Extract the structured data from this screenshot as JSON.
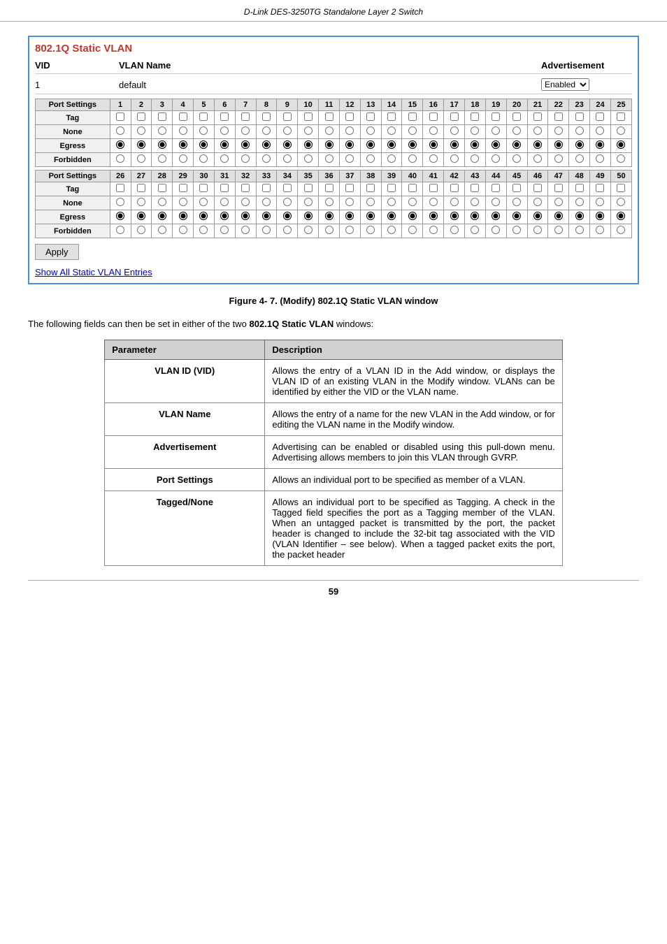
{
  "header": {
    "title": "D-Link DES-3250TG Standalone Layer 2 Switch"
  },
  "vlan_panel": {
    "title": "802.1Q Static VLAN",
    "vid_label": "VID",
    "vlan_name_label": "VLAN Name",
    "advertisement_label": "Advertisement",
    "vid_value": "1",
    "vlan_name_value": "default",
    "advertisement_value": "Enabled",
    "port_settings_label": "Port Settings",
    "tag_label": "Tag",
    "none_label": "None",
    "egress_label": "Egress",
    "forbidden_label": "Forbidden",
    "ports_row1": [
      1,
      2,
      3,
      4,
      5,
      6,
      7,
      8,
      9,
      10,
      11,
      12,
      13,
      14,
      15,
      16,
      17,
      18,
      19,
      20,
      21,
      22,
      23,
      24,
      25
    ],
    "ports_row2": [
      26,
      27,
      28,
      29,
      30,
      31,
      32,
      33,
      34,
      35,
      36,
      37,
      38,
      39,
      40,
      41,
      42,
      43,
      44,
      45,
      46,
      47,
      48,
      49,
      50
    ],
    "apply_label": "Apply",
    "show_all_link": "Show All Static VLAN Entries"
  },
  "figure_caption": "Figure 4- 7.  (Modify) 802.1Q Static VLAN window",
  "description_intro": "The following fields can then be set in either of the two",
  "description_bold": "802.1Q Static VLAN",
  "description_end": "windows:",
  "param_table": {
    "col1": "Parameter",
    "col2": "Description",
    "rows": [
      {
        "param": "VLAN ID (VID)",
        "desc": "Allows the entry of a VLAN ID in the Add window, or displays the VLAN ID of an existing VLAN in the Modify window. VLANs can be identified by either the VID or the VLAN name."
      },
      {
        "param": "VLAN Name",
        "desc": "Allows the entry of a name for the new VLAN in the Add window, or for editing the VLAN name in the Modify window."
      },
      {
        "param": "Advertisement",
        "desc": "Advertising can be enabled or disabled using this pull-down menu.  Advertising allows members to join  this  VLAN through GVRP."
      },
      {
        "param": "Port Settings",
        "desc": "Allows an individual port to be specified as member of a VLAN."
      },
      {
        "param": "Tagged/None",
        "desc": "Allows an individual port to be specified as Tagging.  A check in the Tagged field specifies the port as a Tagging member of the VLAN. When an untagged packet is transmitted by the port, the packet header is changed to include the 32-bit tag associated with the VID (VLAN Identifier – see below). When a tagged packet exits the port, the packet header"
      }
    ]
  },
  "page_number": "59"
}
